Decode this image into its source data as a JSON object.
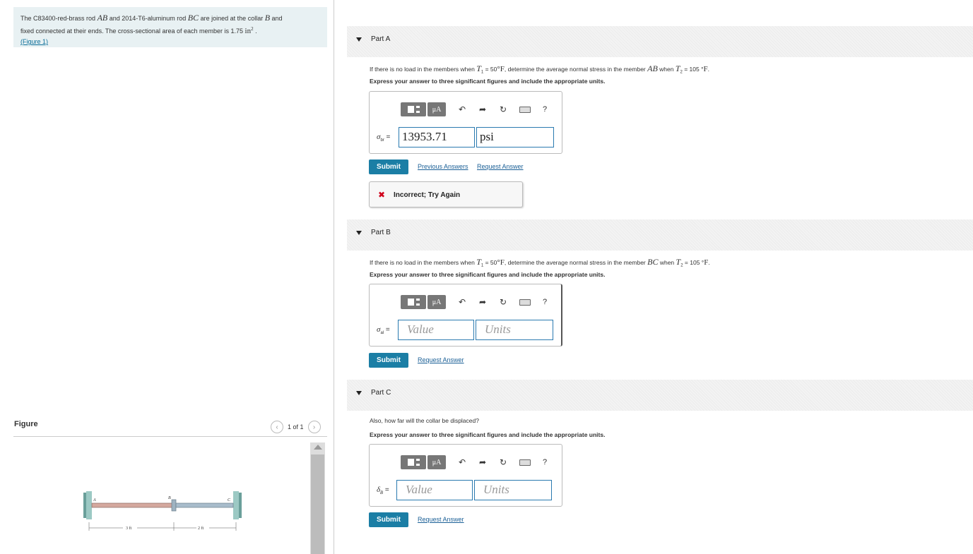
{
  "problem": {
    "text_1": "The C83400-red-brass rod ",
    "math_ab": "AB",
    "text_2": " and 2014-T6-aluminum rod ",
    "math_bc": "BC",
    "text_3": " are joined at the collar ",
    "math_b": "B",
    "text_4": " and",
    "text_5": "fixed connected at their ends. The cross-sectional area of each member is 1.75 ",
    "unit_area": "in",
    "unit_exp": "2",
    "text_6": " .",
    "figure_link": "(Figure 1)"
  },
  "figure": {
    "label": "Figure",
    "counter": "1 of 1",
    "prev_icon": "chevron-left-icon",
    "next_icon": "chevron-right-icon",
    "labels": {
      "a": "A",
      "b": "B",
      "c": "C",
      "len_ab": "3 ft",
      "len_bc": "2 ft"
    }
  },
  "partA": {
    "title": "Part A",
    "q1": "If there is no load in the members when ",
    "t1": "T",
    "t1sub": "1",
    "q2": " = 50",
    "q2u": "°F",
    "q3": ", determine the average normal stress in the member ",
    "member": "AB",
    "q4": " when ",
    "t2": "T",
    "t2sub": "2",
    "q5": " = 105 °",
    "q5u": "F",
    "q6": ".",
    "instruction": "Express your answer to three significant figures and include the appropriate units.",
    "symbol": "σ",
    "symbol_sub": "br",
    "eq": " =",
    "value": "13953.71",
    "units": "psi",
    "submit": "Submit",
    "previous_answers": "Previous Answers",
    "request_answer": "Request Answer",
    "feedback": "Incorrect; Try Again",
    "feedback_icon": "x-icon"
  },
  "partB": {
    "title": "Part B",
    "q1": "If there is no load in the members when ",
    "t1": "T",
    "t1sub": "1",
    "q2": " = 50",
    "q2u": "°F",
    "q3": ", determine the average normal stress in the member ",
    "member": "BC",
    "q4": " when ",
    "t2": "T",
    "t2sub": "2",
    "q5": " = 105 °",
    "q5u": "F",
    "q6": ".",
    "instruction": "Express your answer to three significant figures and include the appropriate units.",
    "symbol": "σ",
    "symbol_sub": "al",
    "eq": " =",
    "value_placeholder": "Value",
    "units_placeholder": "Units",
    "submit": "Submit",
    "request_answer": "Request Answer"
  },
  "partC": {
    "title": "Part C",
    "question": "Also, how far will the collar be displaced?",
    "instruction": "Express your answer to three significant figures and include the appropriate units.",
    "symbol": "δ",
    "symbol_sub": "B",
    "eq": " =",
    "value_placeholder": "Value",
    "units_placeholder": "Units",
    "submit": "Submit",
    "request_answer": "Request Answer"
  },
  "toolbar": {
    "mu_label": "μA",
    "help_label": "?",
    "icons": [
      "templates-icon",
      "units-icon",
      "undo-icon",
      "redo-icon",
      "reset-icon",
      "keyboard-icon",
      "help-icon"
    ]
  }
}
